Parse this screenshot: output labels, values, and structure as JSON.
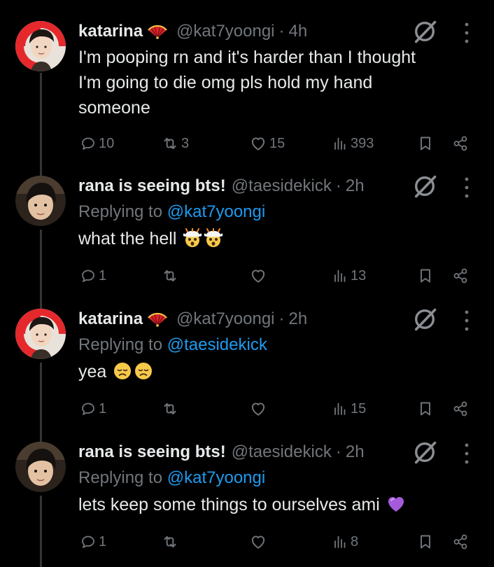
{
  "tweets": [
    {
      "name": "katarina",
      "has_fan_emoji": true,
      "handle": "@kat7yoongi",
      "separator": "·",
      "time": "4h",
      "replying_prefix": "",
      "replying_to": "",
      "text_lines": [
        "I'm pooping rn and it's harder than I thought",
        "I'm going to die omg pls hold my hand",
        "someone"
      ],
      "emoji": "",
      "replies": "10",
      "retweets": "3",
      "likes": "15",
      "views": "393"
    },
    {
      "name": "rana is seeing bts!",
      "has_fan_emoji": false,
      "handle": "@taesidekick",
      "separator": "·",
      "time": "2h",
      "replying_prefix": "Replying to",
      "replying_to": "@kat7yoongi",
      "text": "what the hell",
      "emoji": "exploding-head-emoji x2",
      "replies": "1",
      "retweets": "",
      "likes": "",
      "views": "13"
    },
    {
      "name": "katarina",
      "has_fan_emoji": true,
      "handle": "@kat7yoongi",
      "separator": "·",
      "time": "2h",
      "replying_prefix": "Replying to",
      "replying_to": "@taesidekick",
      "text": "yea",
      "emoji": "disappointed-face-emoji x2",
      "replies": "1",
      "retweets": "",
      "likes": "",
      "views": "15"
    },
    {
      "name": "rana is seeing bts!",
      "has_fan_emoji": false,
      "handle": "@taesidekick",
      "separator": "·",
      "time": "2h",
      "replying_prefix": "Replying to",
      "replying_to": "@kat7yoongi",
      "text": "lets keep some things to ourselves ami",
      "emoji": "purple-heart-emoji",
      "replies": "1",
      "retweets": "",
      "likes": "",
      "views": "8"
    }
  ],
  "icons": {
    "fan": "fan-emoji",
    "grok": "grok-icon",
    "more": "more-icon",
    "reply": "reply-icon",
    "retweet": "retweet-icon",
    "like": "heart-icon",
    "views": "views-icon",
    "bookmark": "bookmark-icon",
    "share": "share-icon"
  },
  "colors": {
    "background": "#000000",
    "text": "#e7e9ea",
    "muted": "#71767b",
    "link": "#1d9bf0",
    "thread_line": "#333639"
  }
}
